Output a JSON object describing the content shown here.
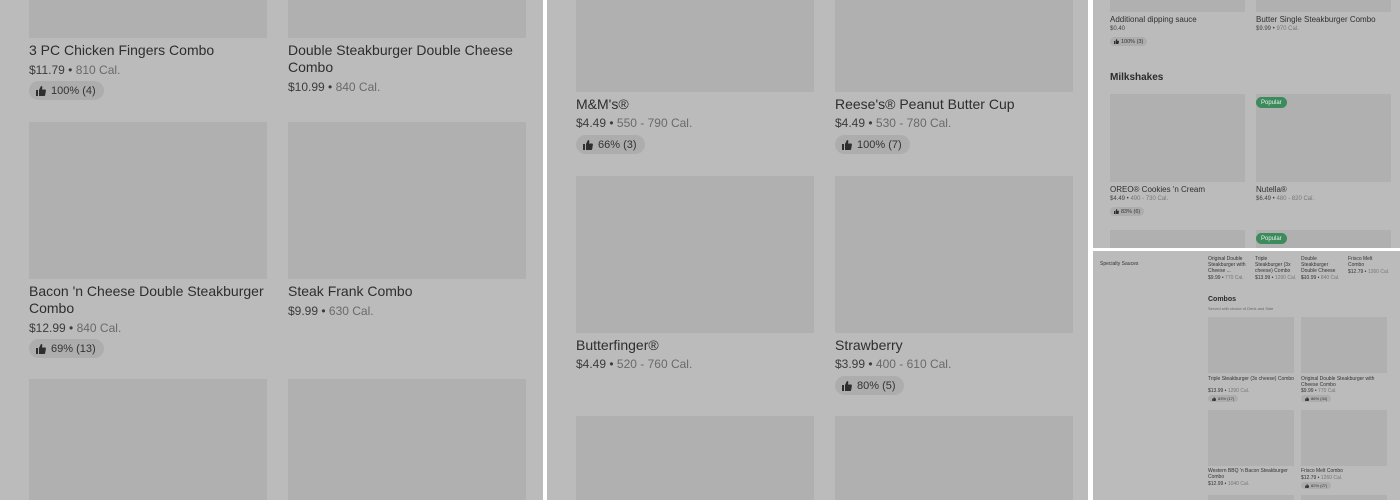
{
  "panel_a": {
    "items": [
      {
        "title": "3 PC Chicken Fingers Combo",
        "price": "$11.79",
        "cal": "810 Cal.",
        "rating": "100% (4)"
      },
      {
        "title": "Double Steakburger Double Cheese Combo",
        "price": "$10.99",
        "cal": "840 Cal."
      },
      {
        "title": "Bacon 'n Cheese Double Steakburger Combo",
        "price": "$12.99",
        "cal": "840 Cal.",
        "rating": "69% (13)"
      },
      {
        "title": "Steak Frank Combo",
        "price": "$9.99",
        "cal": "630 Cal."
      }
    ]
  },
  "panel_b": {
    "items": [
      {
        "title": "M&M's®",
        "price": "$4.49",
        "cal": "550 - 790 Cal.",
        "rating": "66% (3)"
      },
      {
        "title": "Reese's® Peanut Butter Cup",
        "price": "$4.49",
        "cal": "530 - 780 Cal.",
        "rating": "100% (7)"
      },
      {
        "title": "Butterfinger®",
        "price": "$4.49",
        "cal": "520 - 760 Cal."
      },
      {
        "title": "Strawberry",
        "price": "$3.99",
        "cal": "400 - 610 Cal.",
        "rating": "80% (5)"
      }
    ]
  },
  "panel_c": {
    "top_items": [
      {
        "title": "Additional dipping sauce",
        "price": "$0.40",
        "rating": "100% (3)"
      },
      {
        "title": "Butter Single Steakburger Combo",
        "price": "$9.99",
        "cal": "970 Cal."
      }
    ],
    "section_title": "Milkshakes",
    "popular_label": "Popular",
    "shakes": [
      {
        "title": "OREO® Cookies 'n Cream",
        "price": "$4.49",
        "cal": "490 - 730 Cal.",
        "rating": "83% (6)"
      },
      {
        "title": "Nutella®",
        "price": "$6.49",
        "cal": "480 - 820 Cal."
      }
    ]
  },
  "panel_d": {
    "sidebar_label": "Specialty Sauces",
    "top_items": [
      {
        "title": "Original Double Steakburger with Cheese ...",
        "price": "$9.99",
        "cal": "770 Cal."
      },
      {
        "title": "Triple Steakburger (3x cheese) Combo",
        "price": "$13.99",
        "cal": "1290 Cal."
      },
      {
        "title": "Double Steakburger Double Cheese ...",
        "price": "$10.99",
        "cal": "840 Cal."
      },
      {
        "title": "Frisco Melt Combo",
        "price": "$12.79",
        "cal": "1260 Cal."
      }
    ],
    "section_title": "Combos",
    "section_subtitle": "Served with choice of Drink and Side",
    "grid_items": [
      {
        "title": "Triple Steakburger (3x cheese) Combo",
        "price": "$13.99",
        "cal": "1290 Cal.",
        "rating": "83% (17)"
      },
      {
        "title": "Original Double Steakburger with Cheese Combo",
        "price": "$9.99",
        "cal": "770 Cal.",
        "rating": "86% (34)"
      },
      {
        "title": "Western BBQ 'n Bacon Steakburger Combo",
        "price": "$12.99",
        "cal": "1040 Cal."
      },
      {
        "title": "Frisco Melt Combo",
        "price": "$12.79",
        "cal": "1260 Cal.",
        "rating": "82% (27)"
      }
    ]
  }
}
